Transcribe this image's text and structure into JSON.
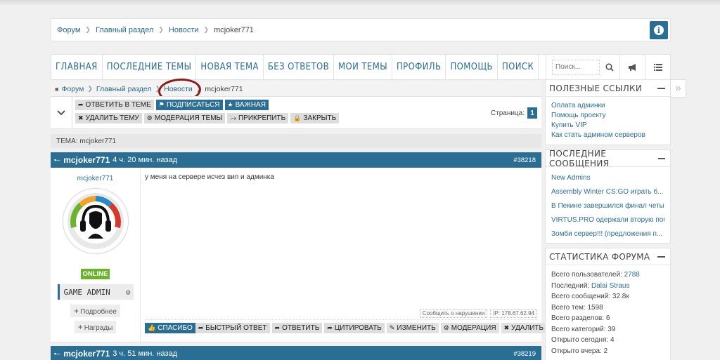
{
  "breadcrumb_top": {
    "items": [
      "Форум",
      "Главный раздел",
      "Новости"
    ],
    "current": "mcjoker771"
  },
  "nav": {
    "items": [
      "ГЛАВНАЯ",
      "ПОСЛЕДНИЕ ТЕМЫ",
      "НОВАЯ ТЕМА",
      "БЕЗ ОТВЕТОВ",
      "МОИ ТЕМЫ",
      "ПРОФИЛЬ",
      "ПОМОЩЬ",
      "ПОИСК"
    ],
    "search_placeholder": "Поиск..."
  },
  "breadcrumb_sub": {
    "items": [
      "Форум",
      "Главный раздел",
      "Новости"
    ],
    "current": "mcjoker771"
  },
  "toolbar": {
    "row1": [
      "ОТВЕТИТЬ В ТЕМЕ",
      "ПОДПИСАТЬСЯ",
      "ВАЖНАЯ"
    ],
    "row2": [
      "УДАЛИТЬ ТЕМУ",
      "МОДЕРАЦИЯ ТЕМЫ",
      "ПРИКРЕПИТЬ",
      "ЗАКРЫТЬ"
    ],
    "page_label": "Страница:",
    "page_num": "1"
  },
  "topic": {
    "label": "ТЕМА: mcjoker771"
  },
  "post1": {
    "author": "mcjoker771",
    "time": "4 ч. 20 мин. назад",
    "id": "#38218",
    "username": "mcjoker771",
    "status": "ONLINE",
    "group": "GAME ADMIN",
    "more1": "Подробнее",
    "more2": "Награды",
    "text": "у меня на сервере исчез вип и админка",
    "report": "Сообщить о нарушении",
    "ip": "IP: 178.67.62.94",
    "thanks": "СПАСИБО",
    "actions": [
      "БЫСТРЫЙ ОТВЕТ",
      "ОТВЕТИТЬ",
      "ЦИТИРОВАТЬ",
      "ИЗМЕНИТЬ",
      "МОДЕРАЦИЯ",
      "УДАЛИТЬ"
    ]
  },
  "post2": {
    "author": "mcjoker771",
    "time": "3 ч. 51 мин. назад",
    "id": "#38219"
  },
  "sidebar": {
    "links_title": "ПОЛЕЗНЫЕ ССЫЛКИ",
    "links": [
      "Оплата админки",
      "Помощь проекту",
      "Купить VIP",
      "Как стать админом серверов"
    ],
    "recent_title": "ПОСЛЕДНИЕ СООБЩЕНИЯ",
    "recent": [
      "New Admins",
      "Assembly Winter CS:GO играть б...",
      "В Пекине завершился финал четы...",
      "VIRTUS.PRO одержали вторую поб...",
      "Зомби сервер!!! (предложения п..."
    ],
    "stats_title": "СТАТИСТИКА ФОРУМА",
    "stats": [
      {
        "label": "Всего пользователей:",
        "value": "2788",
        "link": true
      },
      {
        "label": "Последний:",
        "value": "Dalai Straus",
        "link": true
      },
      {
        "label": "Всего сообщений:",
        "value": "32.8к",
        "link": false
      },
      {
        "label": "Всего тем:",
        "value": "1598",
        "link": false
      },
      {
        "label": "Всего разделов:",
        "value": "6",
        "link": false
      },
      {
        "label": "Всего категорий:",
        "value": "39",
        "link": false
      },
      {
        "label": "Открыто сегодня:",
        "value": "4",
        "link": false
      },
      {
        "label": "Открыто вчера:",
        "value": "2",
        "link": false
      }
    ]
  },
  "colors": {
    "accent": "#2a6f93",
    "online": "#6ab42c",
    "circle_mark": "#8a1c1c"
  }
}
